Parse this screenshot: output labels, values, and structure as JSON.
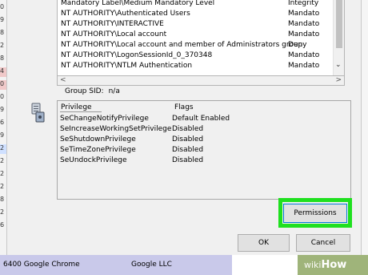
{
  "background_list": {
    "left_digits": [
      "0",
      "9",
      "8",
      "2",
      "8",
      "4",
      "0",
      "0",
      "9",
      "6",
      "9",
      "2",
      "2",
      "2",
      "2",
      "8",
      "2",
      "6"
    ],
    "bottom_row": {
      "process": "6400 Google Chrome",
      "company": "Google LLC"
    }
  },
  "groups": [
    {
      "name": "Mandatory Label\\Medium Mandatory Level",
      "attr": "Integrity"
    },
    {
      "name": "NT AUTHORITY\\Authenticated Users",
      "attr": "Mandato"
    },
    {
      "name": "NT AUTHORITY\\INTERACTIVE",
      "attr": "Mandato"
    },
    {
      "name": "NT AUTHORITY\\Local account",
      "attr": "Mandato"
    },
    {
      "name": "NT AUTHORITY\\Local account and member of Administrators group",
      "attr": "Deny"
    },
    {
      "name": "NT AUTHORITY\\LogonSessionId_0_370348",
      "attr": "Mandato"
    },
    {
      "name": "NT AUTHORITY\\NTLM Authentication",
      "attr": "Mandato"
    }
  ],
  "group_sid": {
    "label": "Group SID:",
    "value": "n/a"
  },
  "privileges": {
    "header_privilege": "Privilege",
    "header_flags": "Flags",
    "rows": [
      {
        "name": "SeChangeNotifyPrivilege",
        "flags": "Default Enabled"
      },
      {
        "name": "SeIncreaseWorkingSetPrivilege",
        "flags": "Disabled"
      },
      {
        "name": "SeShutdownPrivilege",
        "flags": "Disabled"
      },
      {
        "name": "SeTimeZonePrivilege",
        "flags": "Disabled"
      },
      {
        "name": "SeUndockPrivilege",
        "flags": "Disabled"
      }
    ]
  },
  "buttons": {
    "permissions": "Permissions",
    "ok": "OK",
    "cancel": "Cancel"
  },
  "watermark": {
    "wiki": "wiki",
    "how": "How"
  },
  "colors": {
    "highlight": "#1fe01f",
    "selection": "#c9c9ea"
  }
}
